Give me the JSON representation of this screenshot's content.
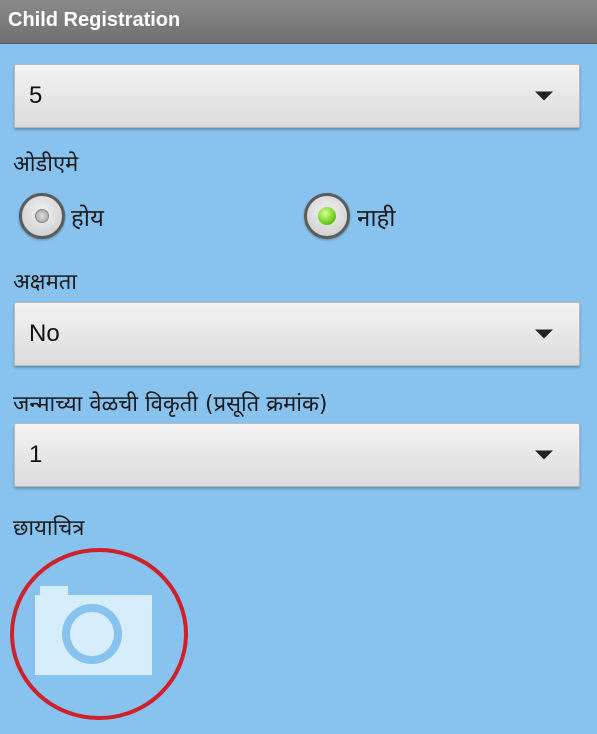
{
  "header": {
    "title": "Child Registration"
  },
  "fields": {
    "first_spinner": {
      "value": "5"
    },
    "odiame": {
      "label": "ओडीएमे",
      "options": [
        {
          "label": "होय",
          "selected": false
        },
        {
          "label": "नाही",
          "selected": true
        }
      ]
    },
    "disability": {
      "label": "अक्षमता",
      "value": "No"
    },
    "birth_defect": {
      "label": "जन्माच्या वेळची विकृती (प्रसूति क्रमांक)",
      "value": "1"
    },
    "photo": {
      "label": "छायाचित्र",
      "icon": "camera-icon"
    }
  },
  "colors": {
    "background": "#87c3ee",
    "titlebar": "#7a7a7a",
    "radio_selected": "#6fcf1e",
    "highlight_circle": "#d0202a"
  }
}
